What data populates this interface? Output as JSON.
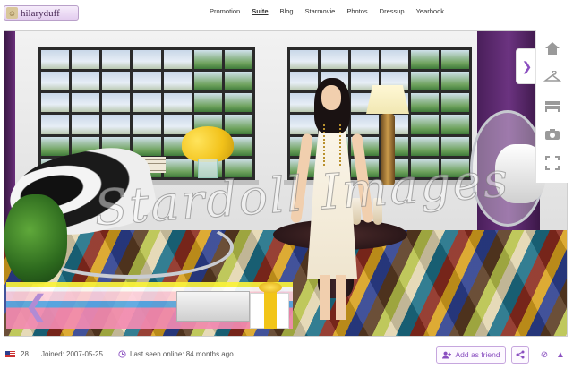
{
  "header": {
    "username": "hilaryduff",
    "nav": [
      {
        "label": "Promotion",
        "active": false
      },
      {
        "label": "Suite",
        "active": true
      },
      {
        "label": "Blog",
        "active": false
      },
      {
        "label": "Starmovie",
        "active": false
      },
      {
        "label": "Photos",
        "active": false
      },
      {
        "label": "Dressup",
        "active": false
      },
      {
        "label": "Yearbook",
        "active": false
      }
    ]
  },
  "scene": {
    "watermark": "Stardoll Images"
  },
  "tools": [
    "expand-icon",
    "hanger-icon",
    "bed-icon",
    "camera-icon",
    "fullscreen-icon"
  ],
  "footer": {
    "level": "28",
    "joined": "Joined: 2007-05-25",
    "last_seen": "Last seen online: 84 months ago",
    "add_friend": "Add as friend"
  },
  "colors": {
    "accent": "#8a4fc0",
    "nav_text": "#333333"
  }
}
